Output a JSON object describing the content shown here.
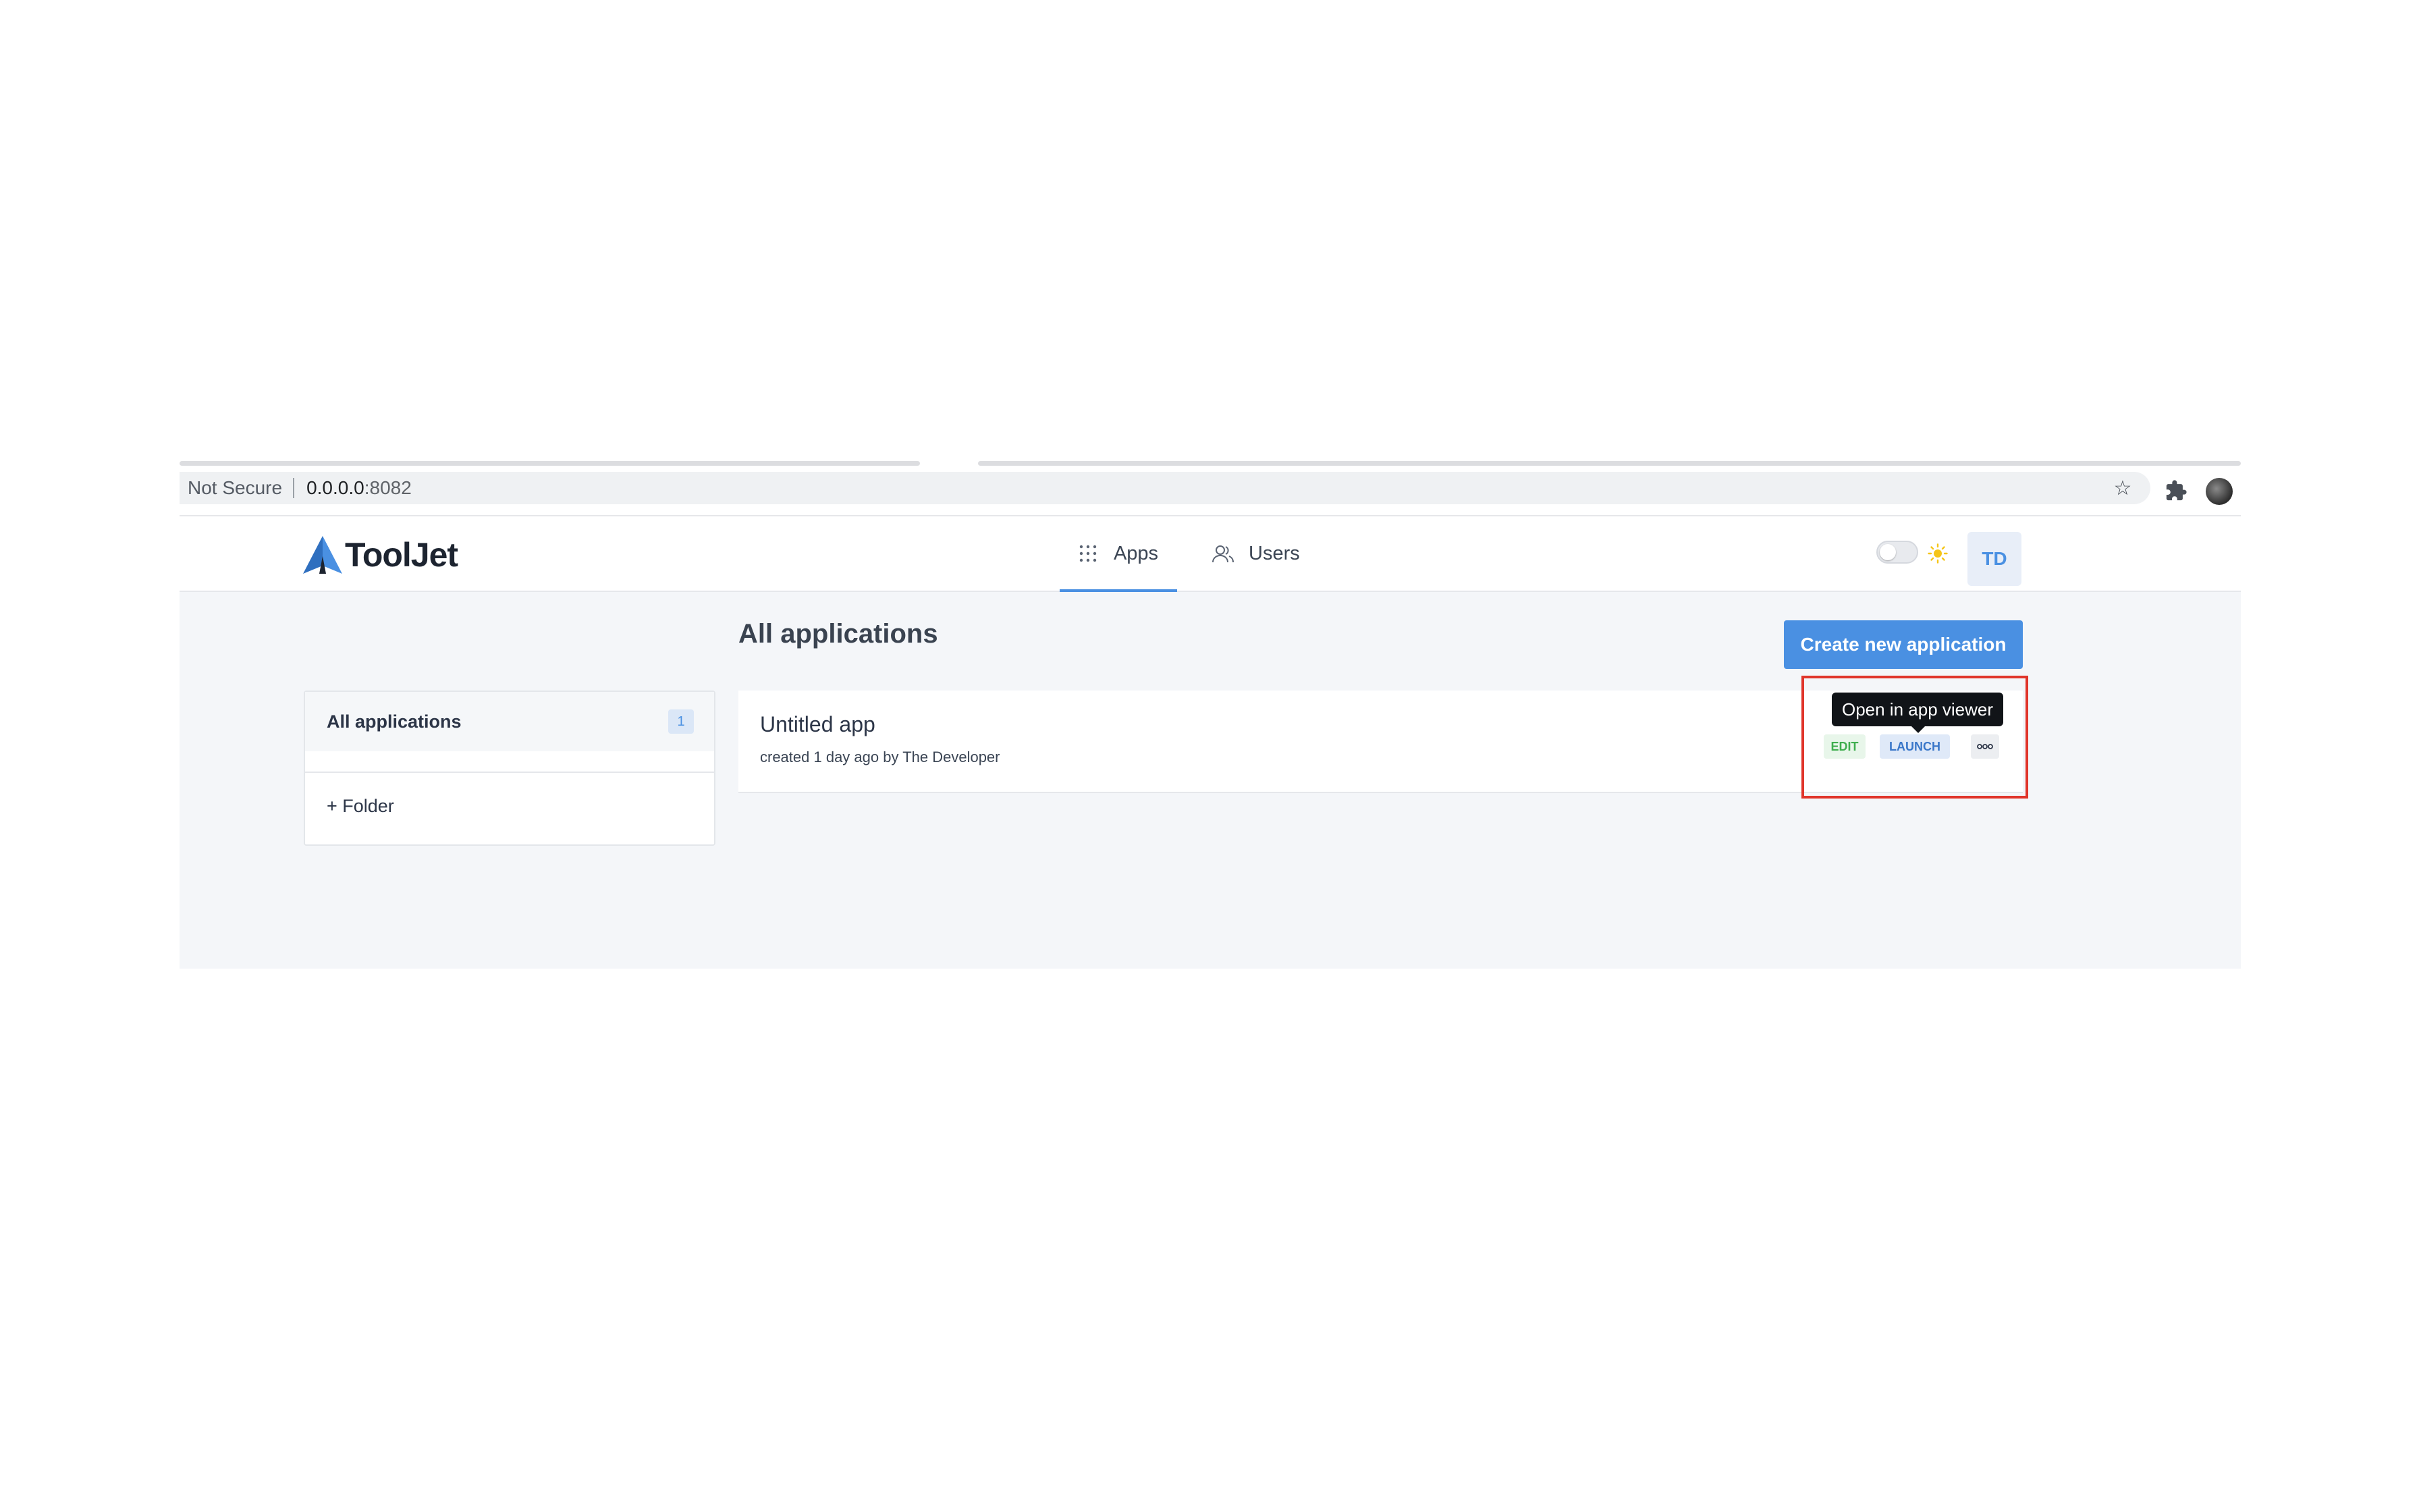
{
  "browser": {
    "security_label": "Not Secure",
    "url_host": "0.0.0.0",
    "url_port": ":8082"
  },
  "brand": {
    "name": "ToolJet",
    "accent_color": "#4a90e2"
  },
  "nav": {
    "tabs": [
      {
        "label": "Apps",
        "icon": "grid-icon",
        "active": true
      },
      {
        "label": "Users",
        "icon": "users-icon",
        "active": false
      }
    ],
    "user_initials": "TD"
  },
  "main": {
    "title": "All applications",
    "create_button": "Create new application"
  },
  "folders": {
    "all_label": "All applications",
    "all_count": "1",
    "add_folder": "+ Folder"
  },
  "apps": [
    {
      "name": "Untitled app",
      "meta": "created 1 day ago by The Developer",
      "edit_label": "EDIT",
      "launch_label": "LAUNCH"
    }
  ],
  "tooltip": {
    "text": "Open in app viewer"
  }
}
